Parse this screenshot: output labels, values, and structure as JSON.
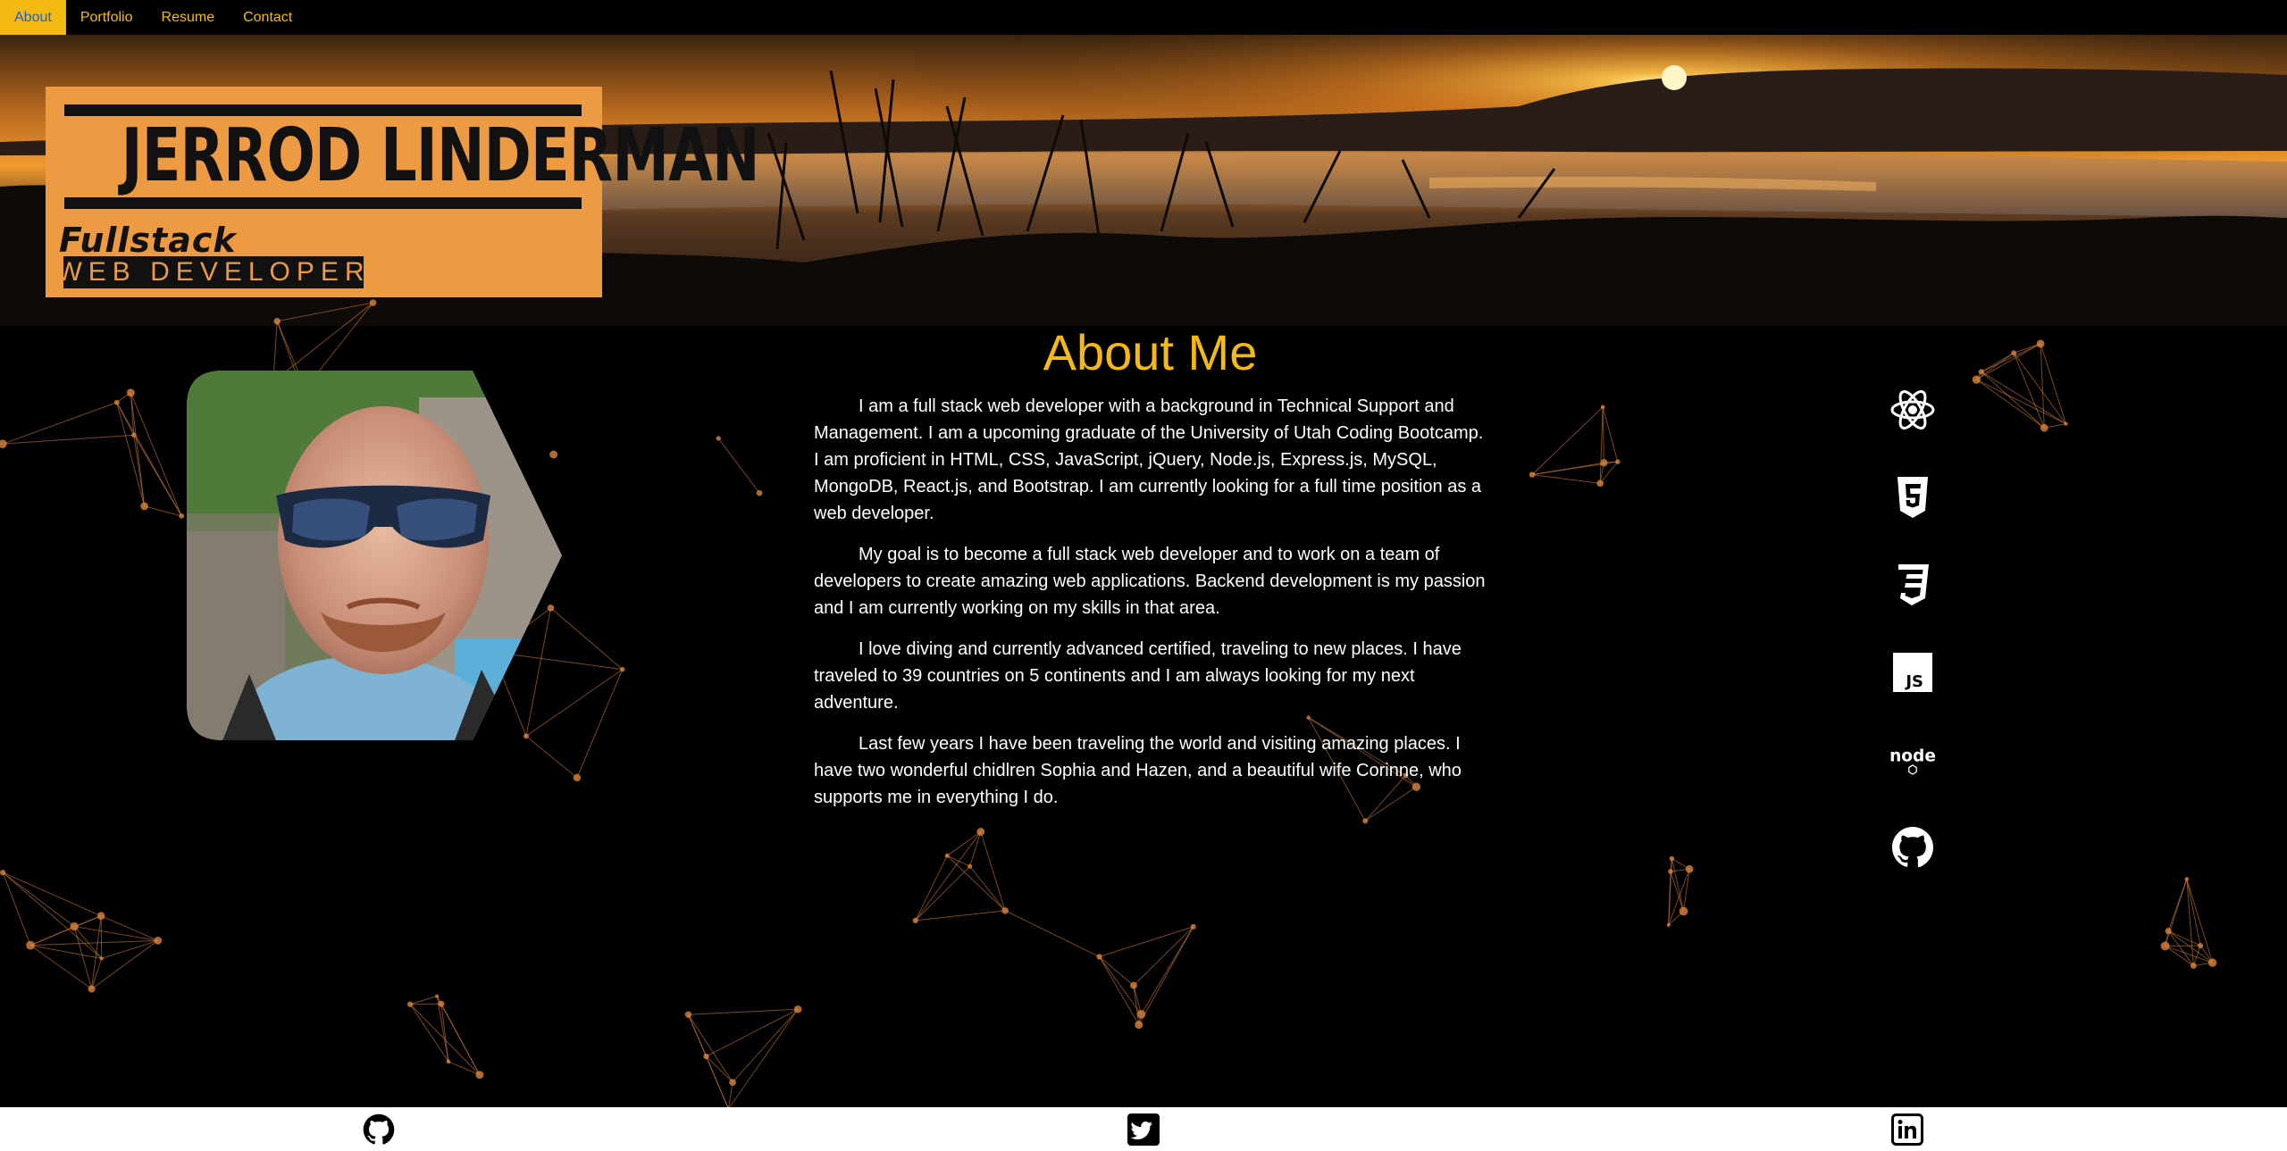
{
  "nav": {
    "items": [
      {
        "label": "About",
        "active": true
      },
      {
        "label": "Portfolio",
        "active": false
      },
      {
        "label": "Resume",
        "active": false
      },
      {
        "label": "Contact",
        "active": false
      }
    ]
  },
  "header": {
    "logo": {
      "name": "JERROD LINDERMAN",
      "line1": "Fullstack",
      "line2": "WEB DEVELOPER"
    },
    "banner_image": "sunset-lake-landscape"
  },
  "about": {
    "title": "About Me",
    "photo": "profile-photo-man-with-sunglasses",
    "paragraphs": [
      "I am a full stack web developer with a background in Technical Support and Management. I am a upcoming graduate of the University of Utah Coding Bootcamp. I am proficient in HTML, CSS, JavaScript, jQuery, Node.js, Express.js, MySQL, MongoDB, React.js, and Bootstrap. I am currently looking for a full time position as a web developer.",
      "My goal is to become a full stack web developer and to work on a team of developers to create amazing web applications. Backend development is my passion and I am currently working on my skills in that area.",
      "I love diving and currently advanced certified, traveling to new places. I have traveled to 39 countries on 5 continents and I am always looking for my next adventure.",
      "Last few years I have been traveling the world and visiting amazing places. I have two wonderful chidlren Sophia and Hazen, and a beautiful wife Corinne, who supports me in everything I do."
    ]
  },
  "tech_icons": [
    "react-icon",
    "html5-icon",
    "css3-icon",
    "javascript-icon",
    "nodejs-icon",
    "github-icon"
  ],
  "footer": {
    "icons": [
      "github-icon",
      "twitter-icon",
      "linkedin-icon"
    ]
  },
  "colors": {
    "accent": "#f5b914",
    "logo_bg": "#ec9b43",
    "background": "#000000",
    "particles": "#d9853b"
  }
}
